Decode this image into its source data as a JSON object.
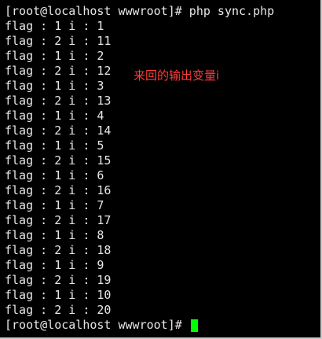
{
  "terminal": {
    "colors": {
      "background": "#000000",
      "text": "#e6e6e6",
      "cursor": "#00ff00",
      "annotation": "#ff3c3c"
    },
    "command_line": "[root@localhost wwwroot]# php sync.php",
    "output": [
      "flag : 1 i : 1",
      "flag : 2 i : 11",
      "flag : 1 i : 2",
      "flag : 2 i : 12",
      "flag : 1 i : 3",
      "flag : 2 i : 13",
      "flag : 1 i : 4",
      "flag : 2 i : 14",
      "flag : 1 i : 5",
      "flag : 2 i : 15",
      "flag : 1 i : 6",
      "flag : 2 i : 16",
      "flag : 1 i : 7",
      "flag : 2 i : 17",
      "flag : 1 i : 8",
      "flag : 2 i : 18",
      "flag : 1 i : 9",
      "flag : 2 i : 19",
      "flag : 1 i : 10",
      "flag : 2 i : 20"
    ],
    "prompt": "[root@localhost wwwroot]# ",
    "annotation": "来回的输出变量i"
  }
}
